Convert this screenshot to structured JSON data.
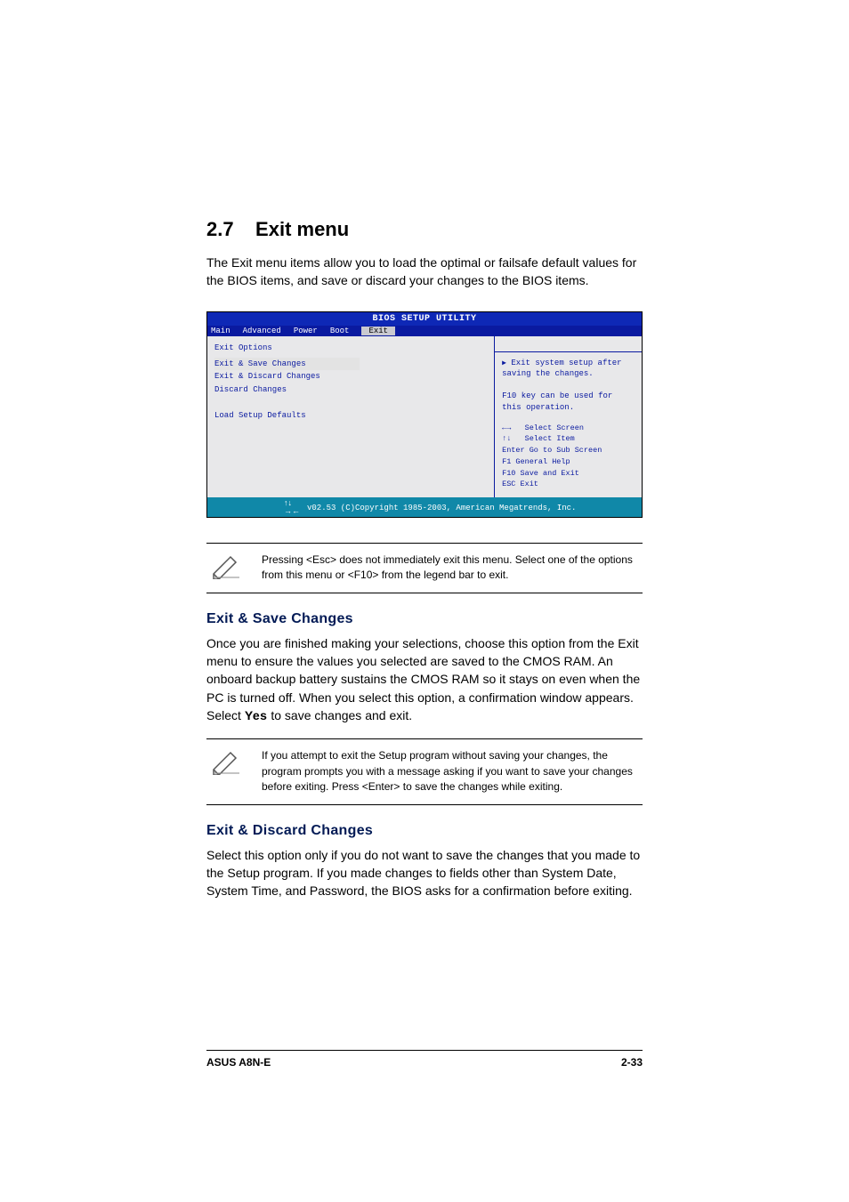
{
  "section": {
    "number": "2.7",
    "title": "Exit menu",
    "intro": "The Exit menu items allow you to load the optimal or failsafe default values for the BIOS items, and save or discard your changes to the BIOS items."
  },
  "bios": {
    "title": "BIOS SETUP UTILITY",
    "menubar": [
      "Main",
      "Advanced",
      "Power",
      "Boot",
      "Exit"
    ],
    "active_tab": "Exit",
    "left_header": "Exit Options",
    "items": [
      "Exit & Save Changes",
      "Exit & Discard Changes",
      "Discard Changes",
      "",
      "Load Setup Defaults"
    ],
    "selected_index": 0,
    "right_help": "Exit system setup after saving the changes.",
    "right_help2": "F10 key can be used for this operation.",
    "keys": [
      "Select Screen",
      "Select Item",
      "Enter  Go to Sub Screen",
      "F1     General Help",
      "F10    Save and Exit",
      "ESC    Exit"
    ],
    "footer": "v02.53 (C)Copyright 1985-2003, American Megatrends, Inc."
  },
  "note1": "Pressing <Esc> does not immediately exit this menu. Select one of the options from this menu or <F10> from the legend bar to exit.",
  "exit_save": {
    "heading": "Exit & Save Changes",
    "body_pre": "Once you are finished making your selections, choose this option from the Exit menu to ensure the values you selected are saved to the CMOS RAM. An onboard backup battery sustains the CMOS RAM so it stays on even when the PC is turned off. When you select this option, a confirmation window appears. Select ",
    "yes": "Yes",
    "body_post": " to save changes and exit."
  },
  "note2": " If you attempt to exit the Setup program without saving your changes, the program prompts you with a message asking if you want to save your changes before exiting. Press <Enter>  to save the  changes while exiting.",
  "exit_discard": {
    "heading": "Exit & Discard Changes",
    "body": "Select this option only if you do not want to save the changes that you made to the Setup program. If you made changes to fields other than System Date, System Time, and Password, the BIOS asks for a confirmation before exiting."
  },
  "footer": {
    "left": "ASUS A8N-E",
    "right": "2-33"
  }
}
